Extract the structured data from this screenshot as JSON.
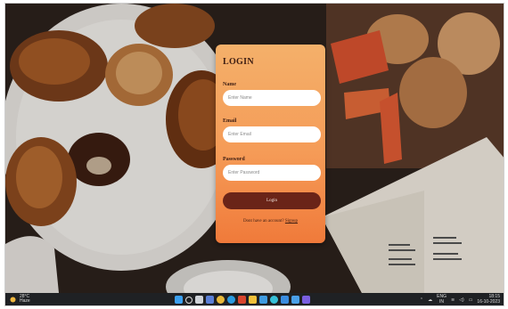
{
  "form": {
    "title": "LOGIN",
    "name_label": "Name",
    "name_placeholder": "Enter Name",
    "email_label": "Email",
    "email_placeholder": "Enter Email",
    "password_label": "Password",
    "password_placeholder": "Enter Password",
    "login_button": "Login",
    "signup_prompt": "Dont have an account?",
    "signup_link": "Signup"
  },
  "taskbar": {
    "temperature": "28°C",
    "weather_text": "Haze",
    "language": "ENG",
    "region": "IN",
    "time": "18:15",
    "date": "16-10-2023",
    "icons": [
      "windows-icon",
      "search-icon",
      "taskview-icon",
      "widgets-icon",
      "chrome-icon",
      "edge-icon",
      "office-icon",
      "folder-icon",
      "store-icon",
      "browser-icon",
      "vscode-icon",
      "mail-icon",
      "app-icon"
    ]
  },
  "colors": {
    "card_top": "#f4b06a",
    "card_bottom": "#f07a3a",
    "button": "#6a2418",
    "text": "#3b1c12"
  }
}
